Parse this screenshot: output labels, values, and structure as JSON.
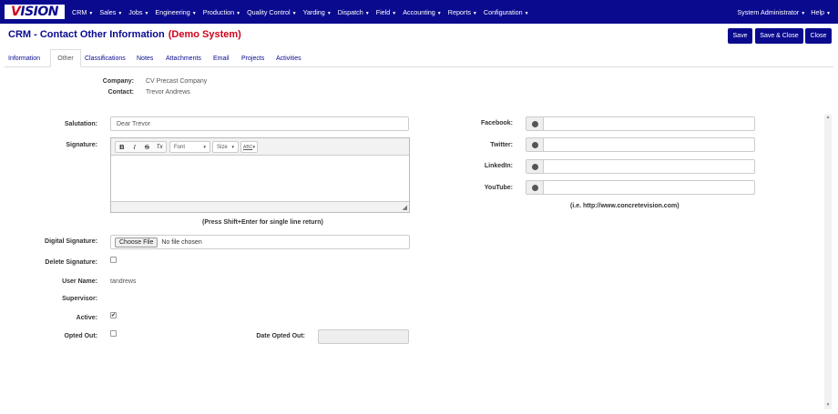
{
  "logo": {
    "text_left": "V",
    "text_right": "ISION"
  },
  "nav": {
    "items": [
      {
        "label": "CRM"
      },
      {
        "label": "Sales"
      },
      {
        "label": "Jobs"
      },
      {
        "label": "Engineering"
      },
      {
        "label": "Production"
      },
      {
        "label": "Quality Control"
      },
      {
        "label": "Yarding"
      },
      {
        "label": "Dispatch"
      },
      {
        "label": "Field"
      },
      {
        "label": "Accounting"
      },
      {
        "label": "Reports"
      },
      {
        "label": "Configuration"
      }
    ],
    "user": "System Administrator",
    "help": "Help",
    "caret": "▼"
  },
  "header": {
    "title": "CRM - Contact Other Information",
    "demo": "(Demo System)",
    "save": "Save",
    "save_close": "Save & Close",
    "close": "Close"
  },
  "tabs": [
    "Information",
    "Other",
    "Classifications",
    "Notes",
    "Attachments",
    "Email",
    "Projects",
    "Activities"
  ],
  "contact": {
    "company_label": "Company:",
    "company": "CV Precast Company",
    "contact_label": "Contact:",
    "contact": "Trevor Andrews"
  },
  "form": {
    "salutation_label": "Salutation:",
    "salutation_placeholder": "Dear Trevor",
    "signature_label": "Signature:",
    "signature_hint": "(Press Shift+Enter for single line return)",
    "digital_signature_label": "Digital Signature:",
    "choose_file": "Choose File",
    "no_file": "No file chosen",
    "delete_signature_label": "Delete Signature:",
    "user_name_label": "User Name:",
    "user_name": "tandrews",
    "supervisor_label": "Supervisor:",
    "active_label": "Active:",
    "active_check": "✔",
    "opted_out_label": "Opted Out:",
    "date_opted_out_label": "Date Opted Out:"
  },
  "editor": {
    "bold": "B",
    "italic": "I",
    "strike": "S",
    "clear": "Tx",
    "font": "Font",
    "size": "Size",
    "spell": "ABC",
    "caret": "▼",
    "resize": "◢"
  },
  "social": {
    "facebook_label": "Facebook:",
    "twitter_label": "Twitter:",
    "linkedin_label": "LinkedIn:",
    "youtube_label": "YouTube:",
    "hint": "(i.e. http://www.concretevision.com)"
  },
  "scroll": {
    "up": "▲",
    "down": "▼"
  }
}
